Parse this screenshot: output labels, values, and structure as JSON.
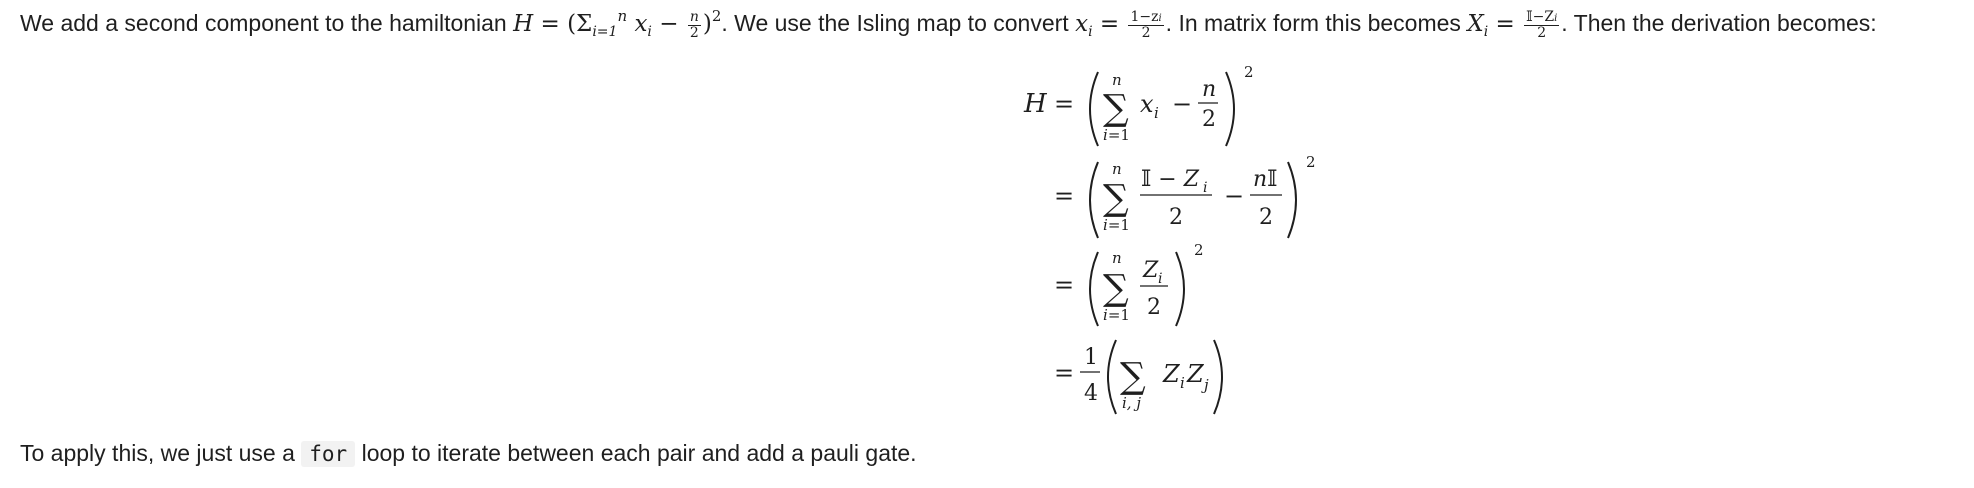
{
  "paragraph1": {
    "text_a": "We add a second component to the hamiltonian ",
    "text_b": ". We use the Isling map to convert ",
    "text_c": ". In matrix form this becomes ",
    "text_d": ". Then the derivation becomes:",
    "inline_H": "H",
    "inline_x": "x",
    "inline_i": "i",
    "inline_n": "n",
    "inline_i_eq_1": "i=1",
    "inline_two": "2",
    "inline_sq": "2",
    "inline_X": "X",
    "inline_frac1_num": "1−z",
    "inline_frac2_num": "𝕀−Z"
  },
  "equation": {
    "lines": [
      "H = ( Σ_{i=1}^{n} x_i − n/2 )^2",
      "= ( Σ_{i=1}^{n} (𝕀 − Z_i)/2 − n𝕀/2 )^2",
      "= ( Σ_{i=1}^{n} Z_i/2 )^2",
      "= 1/4 ( Σ_{i,j} Z_i Z_j )"
    ]
  },
  "paragraph2": {
    "text_a": "To apply this, we just use a ",
    "code": "for",
    "text_b": " loop to iterate between each pair and add a pauli gate."
  }
}
